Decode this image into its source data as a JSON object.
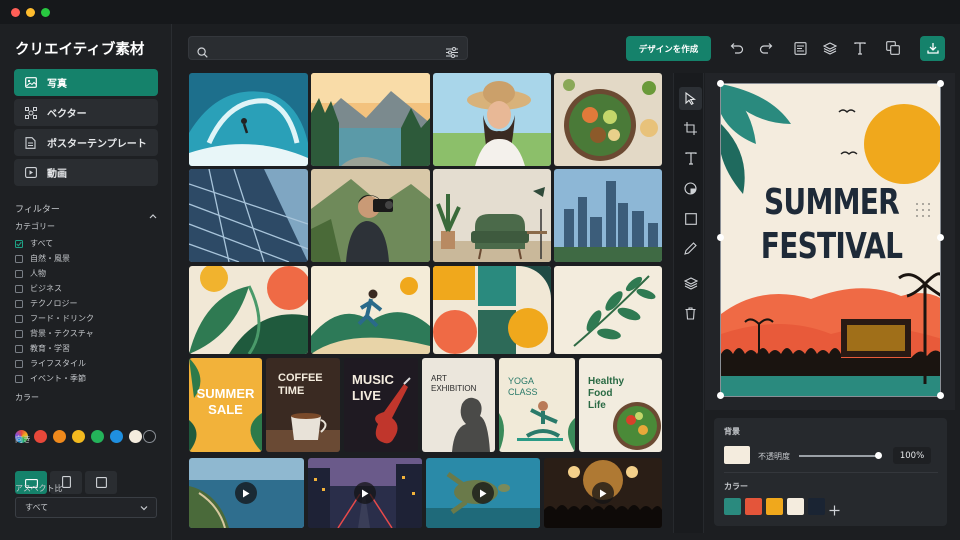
{
  "window": {
    "dots": [
      "#ff5f57",
      "#febc2e",
      "#28c840"
    ]
  },
  "sidebar": {
    "title": "クリエイティブ素材",
    "nav": [
      {
        "label": "写真",
        "active": true,
        "icon": "image-icon"
      },
      {
        "label": "ベクター",
        "active": false,
        "icon": "vector-icon"
      },
      {
        "label": "ポスターテンプレート",
        "active": false,
        "icon": "poster-icon"
      },
      {
        "label": "動画",
        "active": false,
        "icon": "video-icon"
      }
    ],
    "filter_title": "フィルター",
    "category_title": "カテゴリー",
    "categories": [
      {
        "label": "すべて",
        "checked": true
      },
      {
        "label": "自然・風景",
        "checked": false
      },
      {
        "label": "人物",
        "checked": false
      },
      {
        "label": "ビジネス",
        "checked": false
      },
      {
        "label": "テクノロジー",
        "checked": false
      },
      {
        "label": "フード・ドリンク",
        "checked": false
      },
      {
        "label": "背景・テクスチャ",
        "checked": false
      },
      {
        "label": "教育・学習",
        "checked": false
      },
      {
        "label": "ライフスタイル",
        "checked": false
      },
      {
        "label": "イベント・季節",
        "checked": false
      }
    ],
    "color_title": "カラー",
    "colors": [
      "rainbow",
      "#e8483a",
      "#f08a1c",
      "#f2b91f",
      "#24b35a",
      "#1f8fe0",
      "#f4ecde",
      "#1a1c1f"
    ],
    "orientation_title": "向き",
    "orientations": [
      "landscape",
      "portrait",
      "square"
    ],
    "aspect_title": "アスペクト比",
    "aspect_value": "すべて"
  },
  "toolbar": {
    "search_placeholder": "",
    "create_label": "デザインを作成",
    "icons": [
      "undo-icon",
      "redo-icon",
      "align-icon",
      "layers-icon",
      "text-icon",
      "duplicate-icon",
      "download-icon"
    ]
  },
  "gallery": {
    "tiles": [
      {
        "name": "photo-wave-surfer"
      },
      {
        "name": "photo-mountain-lake"
      },
      {
        "name": "photo-smiling-woman-hat"
      },
      {
        "name": "photo-salad-bowl"
      },
      {
        "name": "photo-glass-building"
      },
      {
        "name": "photo-photographer"
      },
      {
        "name": "photo-interior-chair"
      },
      {
        "name": "photo-city-skyline"
      },
      {
        "name": "vector-leaves"
      },
      {
        "name": "vector-runner"
      },
      {
        "name": "vector-geometric"
      },
      {
        "name": "vector-branch"
      }
    ],
    "posters": [
      {
        "name": "poster-summer-sale",
        "lines": [
          "SUMMER",
          "SALE"
        ]
      },
      {
        "name": "poster-coffee-time",
        "lines": [
          "COFFEE",
          "TIME"
        ]
      },
      {
        "name": "poster-music-live",
        "lines": [
          "MUSIC",
          "LIVE"
        ]
      },
      {
        "name": "poster-art-exhibition",
        "lines": [
          "ART",
          "EXHIBITION"
        ]
      },
      {
        "name": "poster-yoga-class",
        "lines": [
          "YOGA",
          "CLASS"
        ]
      },
      {
        "name": "poster-healthy-food",
        "lines": [
          "Healthy",
          "Food",
          "Life"
        ]
      }
    ],
    "videos": [
      {
        "name": "video-coast"
      },
      {
        "name": "video-city-night"
      },
      {
        "name": "video-sea-turtle"
      },
      {
        "name": "video-concert"
      }
    ]
  },
  "tools": [
    "pointer-icon",
    "crop-icon",
    "text-icon",
    "shape-icon",
    "rectangle-icon",
    "pen-icon",
    "layers-icon",
    "trash-icon"
  ],
  "preview": {
    "lines": [
      "SUMMER",
      "FESTIVAL"
    ]
  },
  "properties": {
    "background_title": "背景",
    "opacity_label": "不透明度",
    "opacity_value": "100%",
    "opacity_fraction": 1.0,
    "background_color": "#f4ecde",
    "color_title": "カラー",
    "palette": [
      "#2a8a7e",
      "#e4553a",
      "#f0a81c",
      "#f4ecde",
      "#1a2433"
    ]
  }
}
